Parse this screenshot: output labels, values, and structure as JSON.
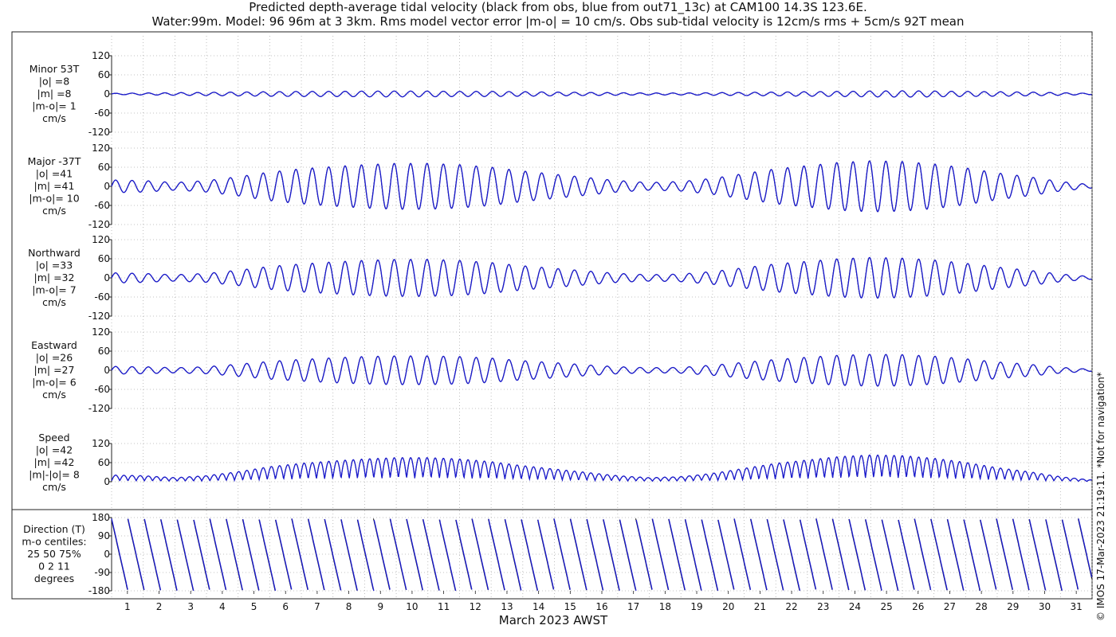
{
  "header": {
    "title_line1": "Predicted depth-average tidal velocity (black from obs, blue from out71_13c) at CAM100 14.3S 123.6E.",
    "title_line2": "Water:99m. Model: 96 96m at 3 3km. Rms model vector error |m-o| = 10 cm/s. Obs sub-tidal velocity is 12cm/s rms + 5cm/s 92T mean"
  },
  "side_note": "© IMOS 17-Mar-2023 21:19:11. *Not for navigation*",
  "colors": {
    "obs": "#000000",
    "model": "#1a1ad0",
    "grid": "#b0b0b0",
    "axis": "#222222"
  },
  "chart_data": [
    {
      "type": "line",
      "panel": "minor",
      "labels": [
        "Minor 53T",
        "|o| =8",
        "|m| =8",
        "|m-o|= 1",
        "cm/s"
      ],
      "yticks": [
        120,
        60,
        0,
        -60,
        -120
      ],
      "ylim": [
        -120,
        120
      ],
      "xlim": [
        0,
        31
      ],
      "series": [
        {
          "name": "obs",
          "x": [
            0,
            1,
            2,
            3,
            4,
            5,
            6,
            7,
            8,
            9,
            10,
            11,
            12,
            13,
            14,
            15,
            16,
            17,
            18,
            19,
            20,
            21,
            22,
            23,
            24,
            25,
            26,
            27,
            28,
            29,
            30,
            31
          ],
          "amplitude": [
            2,
            3,
            4,
            5,
            6,
            7,
            8,
            8,
            9,
            9,
            9,
            8,
            8,
            7,
            6,
            5,
            4,
            3,
            3,
            4,
            5,
            6,
            7,
            8,
            9,
            10,
            9,
            8,
            7,
            6,
            4,
            2
          ]
        },
        {
          "name": "model",
          "x": [
            0,
            1,
            2,
            3,
            4,
            5,
            6,
            7,
            8,
            9,
            10,
            11,
            12,
            13,
            14,
            15,
            16,
            17,
            18,
            19,
            20,
            21,
            22,
            23,
            24,
            25,
            26,
            27,
            28,
            29,
            30,
            31
          ],
          "amplitude": [
            2,
            3,
            4,
            5,
            6,
            7,
            8,
            8,
            9,
            9,
            9,
            8,
            8,
            7,
            6,
            5,
            4,
            3,
            3,
            4,
            5,
            6,
            7,
            8,
            9,
            10,
            9,
            8,
            7,
            6,
            4,
            2
          ]
        }
      ]
    },
    {
      "type": "line",
      "panel": "major",
      "labels": [
        "Major -37T",
        "|o| =41",
        "|m| =41",
        "|m-o|= 10",
        "cm/s"
      ],
      "yticks": [
        120,
        60,
        0,
        -60,
        -120
      ],
      "ylim": [
        -120,
        120
      ],
      "xlim": [
        0,
        31
      ],
      "series": [
        {
          "name": "obs",
          "x": [
            0,
            1,
            2,
            3,
            4,
            5,
            6,
            7,
            8,
            9,
            10,
            11,
            12,
            13,
            14,
            15,
            16,
            17,
            18,
            19,
            20,
            21,
            22,
            23,
            24,
            25,
            26,
            27,
            28,
            29,
            30,
            31
          ],
          "amplitude": [
            20,
            18,
            12,
            18,
            30,
            45,
            55,
            62,
            68,
            72,
            72,
            68,
            60,
            48,
            38,
            28,
            18,
            12,
            15,
            25,
            40,
            55,
            65,
            75,
            80,
            78,
            70,
            58,
            42,
            30,
            15,
            5
          ]
        },
        {
          "name": "model",
          "x": [
            0,
            1,
            2,
            3,
            4,
            5,
            6,
            7,
            8,
            9,
            10,
            11,
            12,
            13,
            14,
            15,
            16,
            17,
            18,
            19,
            20,
            21,
            22,
            23,
            24,
            25,
            26,
            27,
            28,
            29,
            30,
            31
          ],
          "amplitude": [
            20,
            18,
            12,
            18,
            30,
            45,
            55,
            62,
            68,
            72,
            72,
            68,
            60,
            48,
            38,
            28,
            18,
            12,
            15,
            25,
            40,
            55,
            65,
            75,
            80,
            78,
            70,
            58,
            42,
            30,
            15,
            5
          ]
        }
      ]
    },
    {
      "type": "line",
      "panel": "northward",
      "labels": [
        "Northward",
        "|o| =33",
        "|m| =32",
        "|m-o|= 7",
        "cm/s"
      ],
      "yticks": [
        120,
        60,
        0,
        -60,
        -120
      ],
      "ylim": [
        -120,
        120
      ],
      "xlim": [
        0,
        31
      ],
      "series": [
        {
          "name": "obs",
          "x": [
            0,
            1,
            2,
            3,
            4,
            5,
            6,
            7,
            8,
            9,
            10,
            11,
            12,
            13,
            14,
            15,
            16,
            17,
            18,
            19,
            20,
            21,
            22,
            23,
            24,
            25,
            26,
            27,
            28,
            29,
            30,
            31
          ],
          "amplitude": [
            16,
            14,
            10,
            14,
            24,
            36,
            44,
            50,
            55,
            58,
            58,
            55,
            48,
            38,
            30,
            22,
            14,
            10,
            12,
            20,
            32,
            44,
            52,
            60,
            64,
            62,
            56,
            46,
            34,
            24,
            12,
            4
          ]
        },
        {
          "name": "model",
          "x": [
            0,
            1,
            2,
            3,
            4,
            5,
            6,
            7,
            8,
            9,
            10,
            11,
            12,
            13,
            14,
            15,
            16,
            17,
            18,
            19,
            20,
            21,
            22,
            23,
            24,
            25,
            26,
            27,
            28,
            29,
            30,
            31
          ],
          "amplitude": [
            16,
            14,
            10,
            14,
            24,
            36,
            44,
            50,
            55,
            58,
            58,
            55,
            48,
            38,
            30,
            22,
            14,
            10,
            12,
            20,
            32,
            44,
            52,
            60,
            64,
            62,
            56,
            46,
            34,
            24,
            12,
            4
          ]
        }
      ]
    },
    {
      "type": "line",
      "panel": "eastward",
      "labels": [
        "Eastward",
        "|o| =26",
        "|m| =27",
        "|m-o|= 6",
        "cm/s"
      ],
      "yticks": [
        120,
        60,
        0,
        -60,
        -120
      ],
      "ylim": [
        -120,
        120
      ],
      "xlim": [
        0,
        31
      ],
      "series": [
        {
          "name": "obs",
          "x": [
            0,
            1,
            2,
            3,
            4,
            5,
            6,
            7,
            8,
            9,
            10,
            11,
            12,
            13,
            14,
            15,
            16,
            17,
            18,
            19,
            20,
            21,
            22,
            23,
            24,
            25,
            26,
            27,
            28,
            29,
            30,
            31
          ],
          "amplitude": [
            12,
            11,
            8,
            11,
            19,
            28,
            34,
            39,
            43,
            45,
            45,
            43,
            38,
            30,
            24,
            17,
            11,
            8,
            9,
            16,
            25,
            34,
            41,
            47,
            50,
            49,
            44,
            36,
            26,
            19,
            9,
            3
          ]
        },
        {
          "name": "model",
          "x": [
            0,
            1,
            2,
            3,
            4,
            5,
            6,
            7,
            8,
            9,
            10,
            11,
            12,
            13,
            14,
            15,
            16,
            17,
            18,
            19,
            20,
            21,
            22,
            23,
            24,
            25,
            26,
            27,
            28,
            29,
            30,
            31
          ],
          "amplitude": [
            12,
            11,
            8,
            11,
            19,
            28,
            34,
            39,
            43,
            45,
            45,
            43,
            38,
            30,
            24,
            17,
            11,
            8,
            9,
            16,
            25,
            34,
            41,
            47,
            50,
            49,
            44,
            36,
            26,
            19,
            9,
            3
          ]
        }
      ]
    },
    {
      "type": "line",
      "panel": "speed",
      "labels": [
        "Speed",
        "|o| =42",
        "|m| =42",
        "|m|-|o|= 8",
        "cm/s"
      ],
      "yticks": [
        120,
        60,
        0
      ],
      "ylim": [
        0,
        120
      ],
      "xlim": [
        0,
        31
      ],
      "series": [
        {
          "name": "obs",
          "x": [
            0,
            1,
            2,
            3,
            4,
            5,
            6,
            7,
            8,
            9,
            10,
            11,
            12,
            13,
            14,
            15,
            16,
            17,
            18,
            19,
            20,
            21,
            22,
            23,
            24,
            25,
            26,
            27,
            28,
            29,
            30,
            31
          ],
          "amplitude": [
            20,
            18,
            12,
            18,
            30,
            45,
            55,
            62,
            68,
            72,
            72,
            68,
            60,
            48,
            38,
            28,
            18,
            12,
            15,
            25,
            40,
            55,
            65,
            75,
            80,
            78,
            70,
            58,
            42,
            30,
            15,
            5
          ]
        },
        {
          "name": "model",
          "x": [
            0,
            1,
            2,
            3,
            4,
            5,
            6,
            7,
            8,
            9,
            10,
            11,
            12,
            13,
            14,
            15,
            16,
            17,
            18,
            19,
            20,
            21,
            22,
            23,
            24,
            25,
            26,
            27,
            28,
            29,
            30,
            31
          ],
          "amplitude": [
            20,
            18,
            12,
            18,
            30,
            45,
            55,
            62,
            68,
            72,
            72,
            68,
            60,
            48,
            38,
            28,
            18,
            12,
            15,
            25,
            40,
            55,
            65,
            75,
            80,
            78,
            70,
            58,
            42,
            30,
            15,
            5
          ]
        }
      ]
    },
    {
      "type": "line",
      "panel": "direction",
      "labels": [
        "Direction (T)",
        "m-o centiles:",
        "25  50  75%",
        "0   2   11",
        "degrees"
      ],
      "yticks": [
        180,
        90,
        0,
        -90,
        -180
      ],
      "ylim": [
        -180,
        180
      ],
      "xlim": [
        0,
        31
      ],
      "series": [
        {
          "name": "obs",
          "description": "sawtooth, ~2 wraps per day",
          "x": [
            0,
            31
          ],
          "y": [
            -180,
            180
          ]
        },
        {
          "name": "model",
          "description": "sawtooth, ~2 wraps per day",
          "x": [
            0,
            31
          ],
          "y": [
            -180,
            180
          ]
        }
      ]
    }
  ],
  "xaxis": {
    "label": "March 2023 AWST",
    "ticks": [
      "1",
      "2",
      "3",
      "4",
      "5",
      "6",
      "7",
      "8",
      "9",
      "10",
      "11",
      "12",
      "13",
      "14",
      "15",
      "16",
      "17",
      "18",
      "19",
      "20",
      "21",
      "22",
      "23",
      "24",
      "25",
      "26",
      "27",
      "28",
      "29",
      "30",
      "31"
    ]
  }
}
